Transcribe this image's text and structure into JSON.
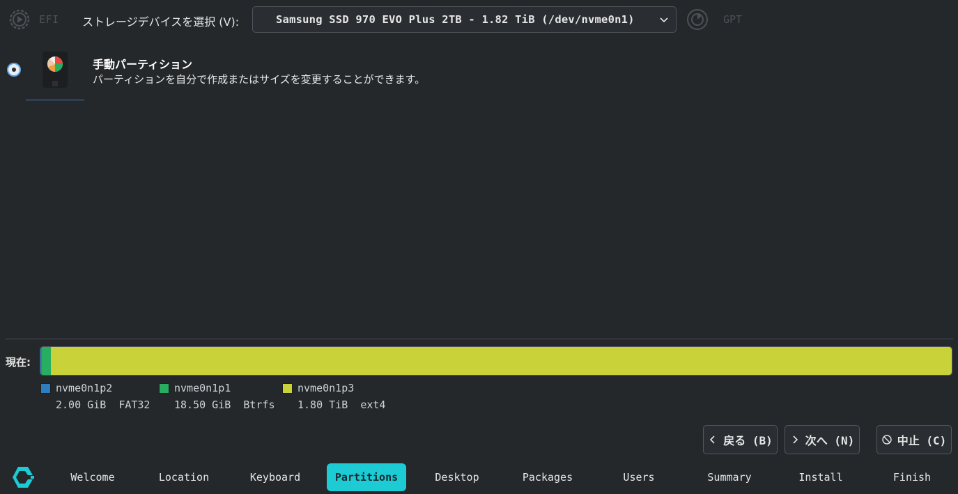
{
  "top": {
    "efi_label": "EFI",
    "device_label": "ストレージデバイスを選択 (V):",
    "device_selected": "Samsung SSD 970 EVO Plus 2TB - 1.82 TiB (/dev/nvme0n1)",
    "gpt_label": "GPT"
  },
  "option": {
    "title": "手動パーティション",
    "description": "パーティションを自分で作成またはサイズを変更することができます。",
    "selected": true
  },
  "current": {
    "label": "現在:",
    "partitions": [
      {
        "name": "nvme0n1p2",
        "size": "2.00 GiB",
        "fs": "FAT32",
        "color": "#2e7dbe",
        "fraction": 0.0011
      },
      {
        "name": "nvme0n1p1",
        "size": "18.50 GiB",
        "fs": "Btrfs",
        "color": "#27ae60",
        "fraction": 0.0099
      },
      {
        "name": "nvme0n1p3",
        "size": "1.80 TiB",
        "fs": "ext4",
        "color": "#c9d238",
        "fraction": 0.989
      }
    ]
  },
  "buttons": {
    "back": "戻る (B)",
    "next": "次へ (N)",
    "cancel": "中止 (C)"
  },
  "steps": [
    "Welcome",
    "Location",
    "Keyboard",
    "Partitions",
    "Desktop",
    "Packages",
    "Users",
    "Summary",
    "Install",
    "Finish"
  ],
  "active_step": "Partitions",
  "colors": {
    "accent": "#1ccbd3",
    "background": "#25282b"
  }
}
